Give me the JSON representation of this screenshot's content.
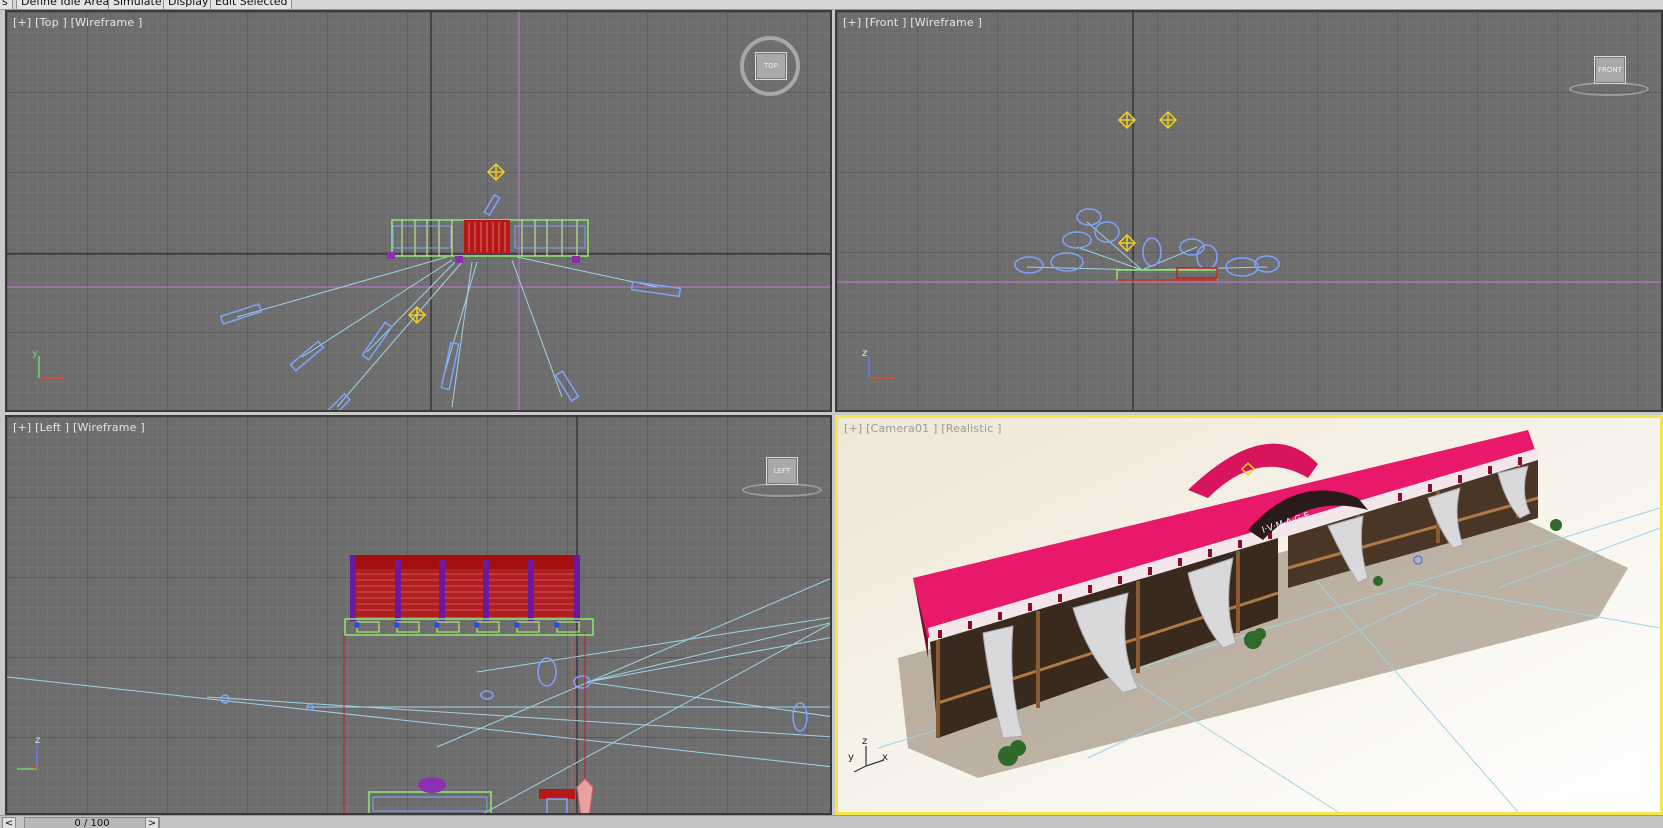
{
  "toolbar": {
    "tabs": [
      {
        "label": "s"
      },
      {
        "label": "Define Idle Areas"
      },
      {
        "label": "Simulate"
      },
      {
        "label": "Display"
      },
      {
        "label": "Edit Selected"
      }
    ]
  },
  "viewports": {
    "top": {
      "label": "[+] [Top ] [Wireframe ]",
      "cube": "TOP",
      "axis_v": "y",
      "axis_h": "x"
    },
    "front": {
      "label": "[+] [Front ] [Wireframe ]",
      "cube": "FRONT",
      "axis_v": "z",
      "axis_h": "x"
    },
    "left": {
      "label": "[+] [Left ] [Wireframe ]",
      "cube": "LEFT",
      "axis_v": "z",
      "axis_h": "x"
    },
    "camera": {
      "label": "[+] [Camera01 ] [Realistic ]",
      "axis_v": "z",
      "axis_h": "x",
      "axis_d": "y",
      "sign_text": "I·V·M·A·G·E"
    }
  },
  "timeline": {
    "frame": "0 / 100",
    "prev": "<",
    "next": ">"
  },
  "colors": {
    "viewport_bg": "#6d6d6d",
    "active_border": "#f3e54a",
    "roof": "#e8186a",
    "wire_blue": "#7fa3ff",
    "light_yellow": "#f0d020"
  }
}
